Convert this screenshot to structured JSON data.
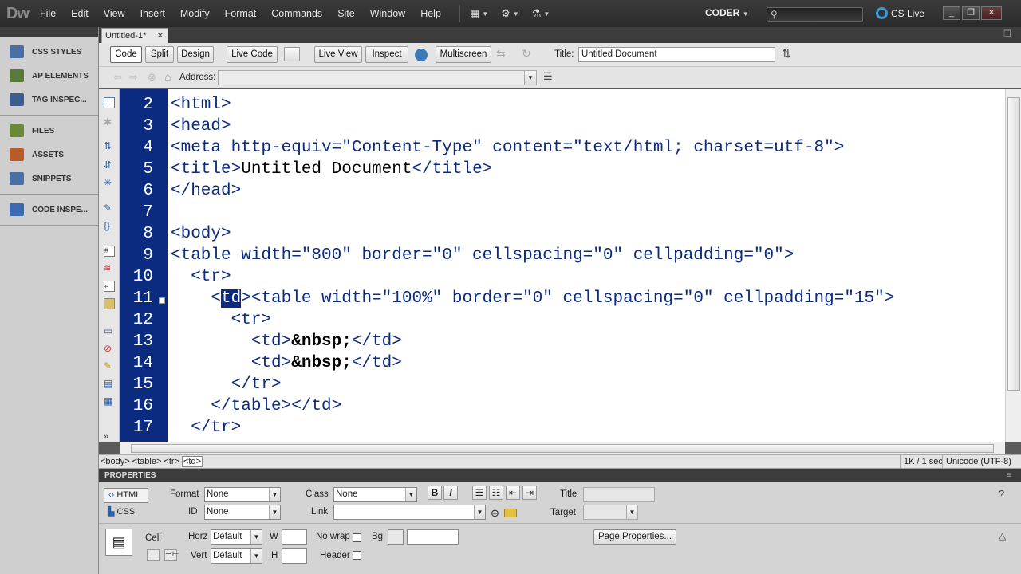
{
  "app": {
    "logo": "Dw",
    "workspace": "CODER",
    "cs_live": "CS Live"
  },
  "menu": [
    "File",
    "Edit",
    "View",
    "Insert",
    "Modify",
    "Format",
    "Commands",
    "Site",
    "Window",
    "Help"
  ],
  "left_panel": {
    "group1": [
      "CSS STYLES",
      "AP ELEMENTS",
      "TAG INSPEC..."
    ],
    "group2": [
      "FILES",
      "ASSETS",
      "SNIPPETS"
    ],
    "group3": [
      "CODE INSPE..."
    ]
  },
  "document_tab": {
    "name": "Untitled-1*",
    "close": "×"
  },
  "doc_toolbar": {
    "code": "Code",
    "split": "Split",
    "design": "Design",
    "live_code": "Live Code",
    "live_view": "Live View",
    "inspect": "Inspect",
    "multiscreen": "Multiscreen",
    "title_label": "Title:",
    "title_value": "Untitled Document"
  },
  "address_bar": {
    "label": "Address:",
    "value": ""
  },
  "code": {
    "line_numbers": [
      "2",
      "3",
      "4",
      "5",
      "6",
      "7",
      "8",
      "9",
      "10",
      "11",
      "12",
      "13",
      "14",
      "15",
      "16",
      "17"
    ],
    "lines": {
      "l2": "<html>",
      "l3": "<head>",
      "l4a": "<meta http-equiv=",
      "l4b": "\"Content-Type\"",
      "l4c": " content=",
      "l4d": "\"text/html; charset=utf-8\"",
      "l4e": ">",
      "l5a": "<title>",
      "l5b": "Untitled Document",
      "l5c": "</title>",
      "l6": "</head>",
      "l8": "<body>",
      "l9": "<table width=\"800\" border=\"0\" cellspacing=\"0\" cellpadding=\"0\">",
      "l10": "  <tr>",
      "l11a": "    <",
      "l11b": "td",
      "l11c": "><table width=\"100%\" border=\"0\" cellspacing=\"0\" cellpadding=\"15\">",
      "l12": "      <tr>",
      "l13a": "        <td>",
      "l13b": "&nbsp;",
      "l13c": "</td>",
      "l14a": "        <td>",
      "l14b": "&nbsp;",
      "l14c": "</td>",
      "l15": "      </tr>",
      "l16": "    </table></td>",
      "l17": "  </tr>"
    }
  },
  "status": {
    "tags": [
      "<body>",
      "<table>",
      "<tr>",
      "<td>"
    ],
    "size": "1K / 1 sec",
    "encoding": "Unicode (UTF-8)"
  },
  "properties": {
    "header": "PROPERTIES",
    "html_tab": "HTML",
    "css_tab": "CSS",
    "format_label": "Format",
    "format_value": "None",
    "id_label": "ID",
    "id_value": "None",
    "class_label": "Class",
    "class_value": "None",
    "link_label": "Link",
    "link_value": "",
    "bold": "B",
    "italic": "I",
    "title_label": "Title",
    "target_label": "Target",
    "cell_label": "Cell",
    "horz_label": "Horz",
    "horz_value": "Default",
    "vert_label": "Vert",
    "vert_value": "Default",
    "w_label": "W",
    "h_label": "H",
    "nowrap_label": "No wrap",
    "header_label": "Header",
    "bg_label": "Bg",
    "page_properties": "Page Properties..."
  }
}
